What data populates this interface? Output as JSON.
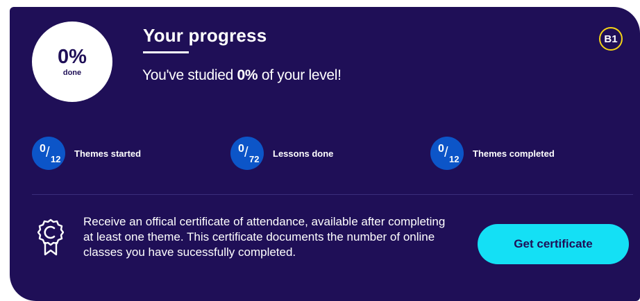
{
  "progress": {
    "percent": "0%",
    "done_label": "done"
  },
  "header": {
    "title": "Your progress",
    "subtitle_prefix": "You've studied ",
    "subtitle_value": "0%",
    "subtitle_suffix": " of your level!",
    "level_badge": "B1"
  },
  "stats": [
    {
      "numerator": "0",
      "denominator": "12",
      "label": "Themes started"
    },
    {
      "numerator": "0",
      "denominator": "72",
      "label": "Lessons done"
    },
    {
      "numerator": "0",
      "denominator": "12",
      "label": "Themes completed"
    }
  ],
  "certificate": {
    "icon": "certificate-icon",
    "text": "Receive an offical certificate of attendance, available after completing at least one theme. This certificate documents the number of online classes you have sucessfully completed.",
    "button_label": "Get certificate"
  },
  "colors": {
    "background": "#1f0f57",
    "stat_circle": "#0c55c8",
    "button": "#14e0f5",
    "badge_border": "#f5d416"
  }
}
